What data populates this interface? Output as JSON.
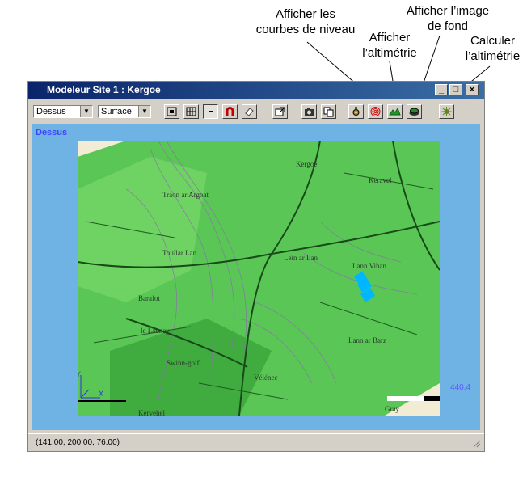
{
  "callouts": {
    "contours": "Afficher les\ncourbes de niveau",
    "altimetry": "Afficher\nl’altimétrie",
    "background": "Afficher l’image\nde fond",
    "compute": "Calculer\nl’altimétrie"
  },
  "window": {
    "title": "Modeleur Site 1 : Kergoe",
    "buttons": {
      "minimize": "_",
      "maximize": "□",
      "close": "×"
    }
  },
  "toolbar": {
    "view_select": "Dessus",
    "mode_select": "Surface"
  },
  "viewport": {
    "label": "Dessus",
    "scale_value": "440.4",
    "map_labels": [
      "Kergoe",
      "Keravel",
      "Traon ar Argoat",
      "Toullar Lan",
      "Barafot",
      "Leïn ar Lan",
      "Lann Vihan",
      "le Launay",
      "Swinn-golf",
      "Lann ar Barz",
      "Vélénec",
      "Kervehel",
      "Gray"
    ]
  },
  "status": {
    "coordinates": "(141.00, 200.00, 76.00)"
  },
  "colors": {
    "title_bar_start": "#0a246a",
    "title_bar_end": "#3a6ea5",
    "viewport_bg": "#6fb2e4",
    "terrain": "#3fbf3f",
    "window_chrome": "#d4d0c8"
  }
}
